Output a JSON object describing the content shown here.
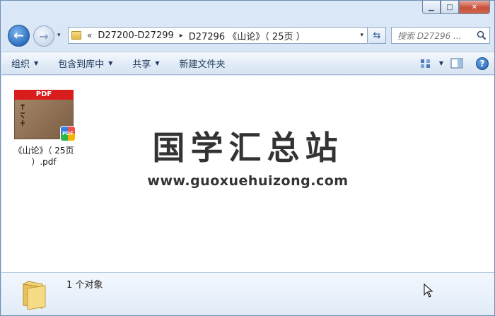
{
  "window": {
    "minimize_glyph": "▁",
    "maximize_glyph": "□",
    "close_glyph": "✕"
  },
  "nav": {
    "back_glyph": "←",
    "forward_glyph": "→",
    "history_drop_glyph": "▾"
  },
  "address": {
    "overflow_glyph": "«",
    "crumbs": [
      "D27200-D27299",
      "D27296 《山论》（ 25页 ）"
    ],
    "separator_glyph": "▸",
    "drop_glyph": "▾",
    "refresh_glyph": "⇆"
  },
  "search": {
    "placeholder": "搜索 D27296 ..."
  },
  "toolbar": {
    "organize": "组织",
    "include_in_library": "包含到库中",
    "share": "共享",
    "new_folder": "新建文件夹",
    "menu_arrow": "▼",
    "help_glyph": "?"
  },
  "files": [
    {
      "name": "《山论》（ 25页 ）.pdf",
      "thumb_band": "PDF",
      "badge": "PDF"
    }
  ],
  "watermark": {
    "title": "国学汇总站",
    "url": "www.guoxuehuizong.com"
  },
  "details": {
    "status": "1 个对象"
  },
  "colors": {
    "accent": "#2a6fc0",
    "pdf_red": "#d91c1c",
    "close_red": "#c7503a"
  }
}
